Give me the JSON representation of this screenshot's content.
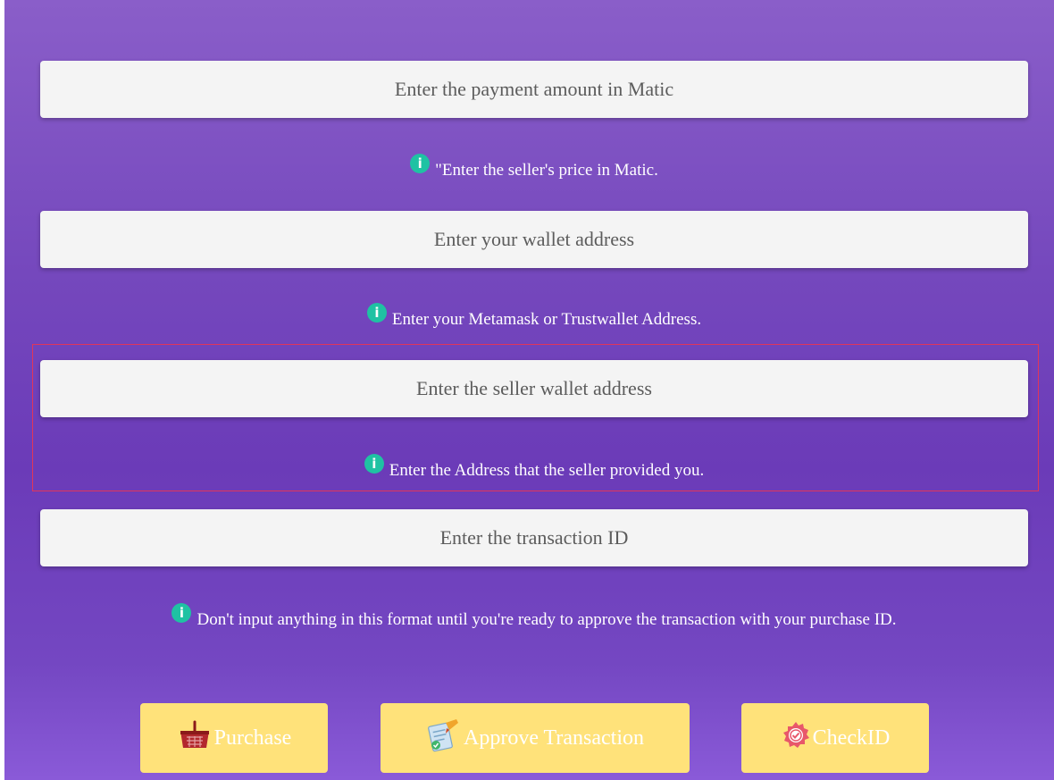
{
  "form": {
    "payment_amount": {
      "placeholder": "Enter the payment amount in Matic",
      "value": ""
    },
    "payment_hint": "\"Enter the seller's price in Matic.",
    "wallet_address": {
      "placeholder": "Enter your wallet address",
      "value": ""
    },
    "wallet_hint": "Enter your Metamask or Trustwallet Address.",
    "seller_address": {
      "placeholder": "Enter the seller wallet address",
      "value": ""
    },
    "seller_hint": "Enter the Address that the seller provided you.",
    "transaction_id": {
      "placeholder": "Enter the transaction ID",
      "value": ""
    },
    "transaction_hint": "Don't input anything in this format until you're ready to approve the transaction with your purchase ID.",
    "info_glyph": "i"
  },
  "buttons": {
    "purchase": {
      "label": "Purchase",
      "icon": "basket-icon"
    },
    "approve": {
      "label": "Approve Transaction",
      "icon": "document-pen-icon"
    },
    "check": {
      "label": "CheckID",
      "icon": "badge-icon"
    }
  },
  "colors": {
    "background_top": "#8a5ec9",
    "background_bottom": "#8a5ad8",
    "info_badge": "#1fc2a3",
    "button": "#ffe27a",
    "highlight_border": "#e0365a"
  }
}
